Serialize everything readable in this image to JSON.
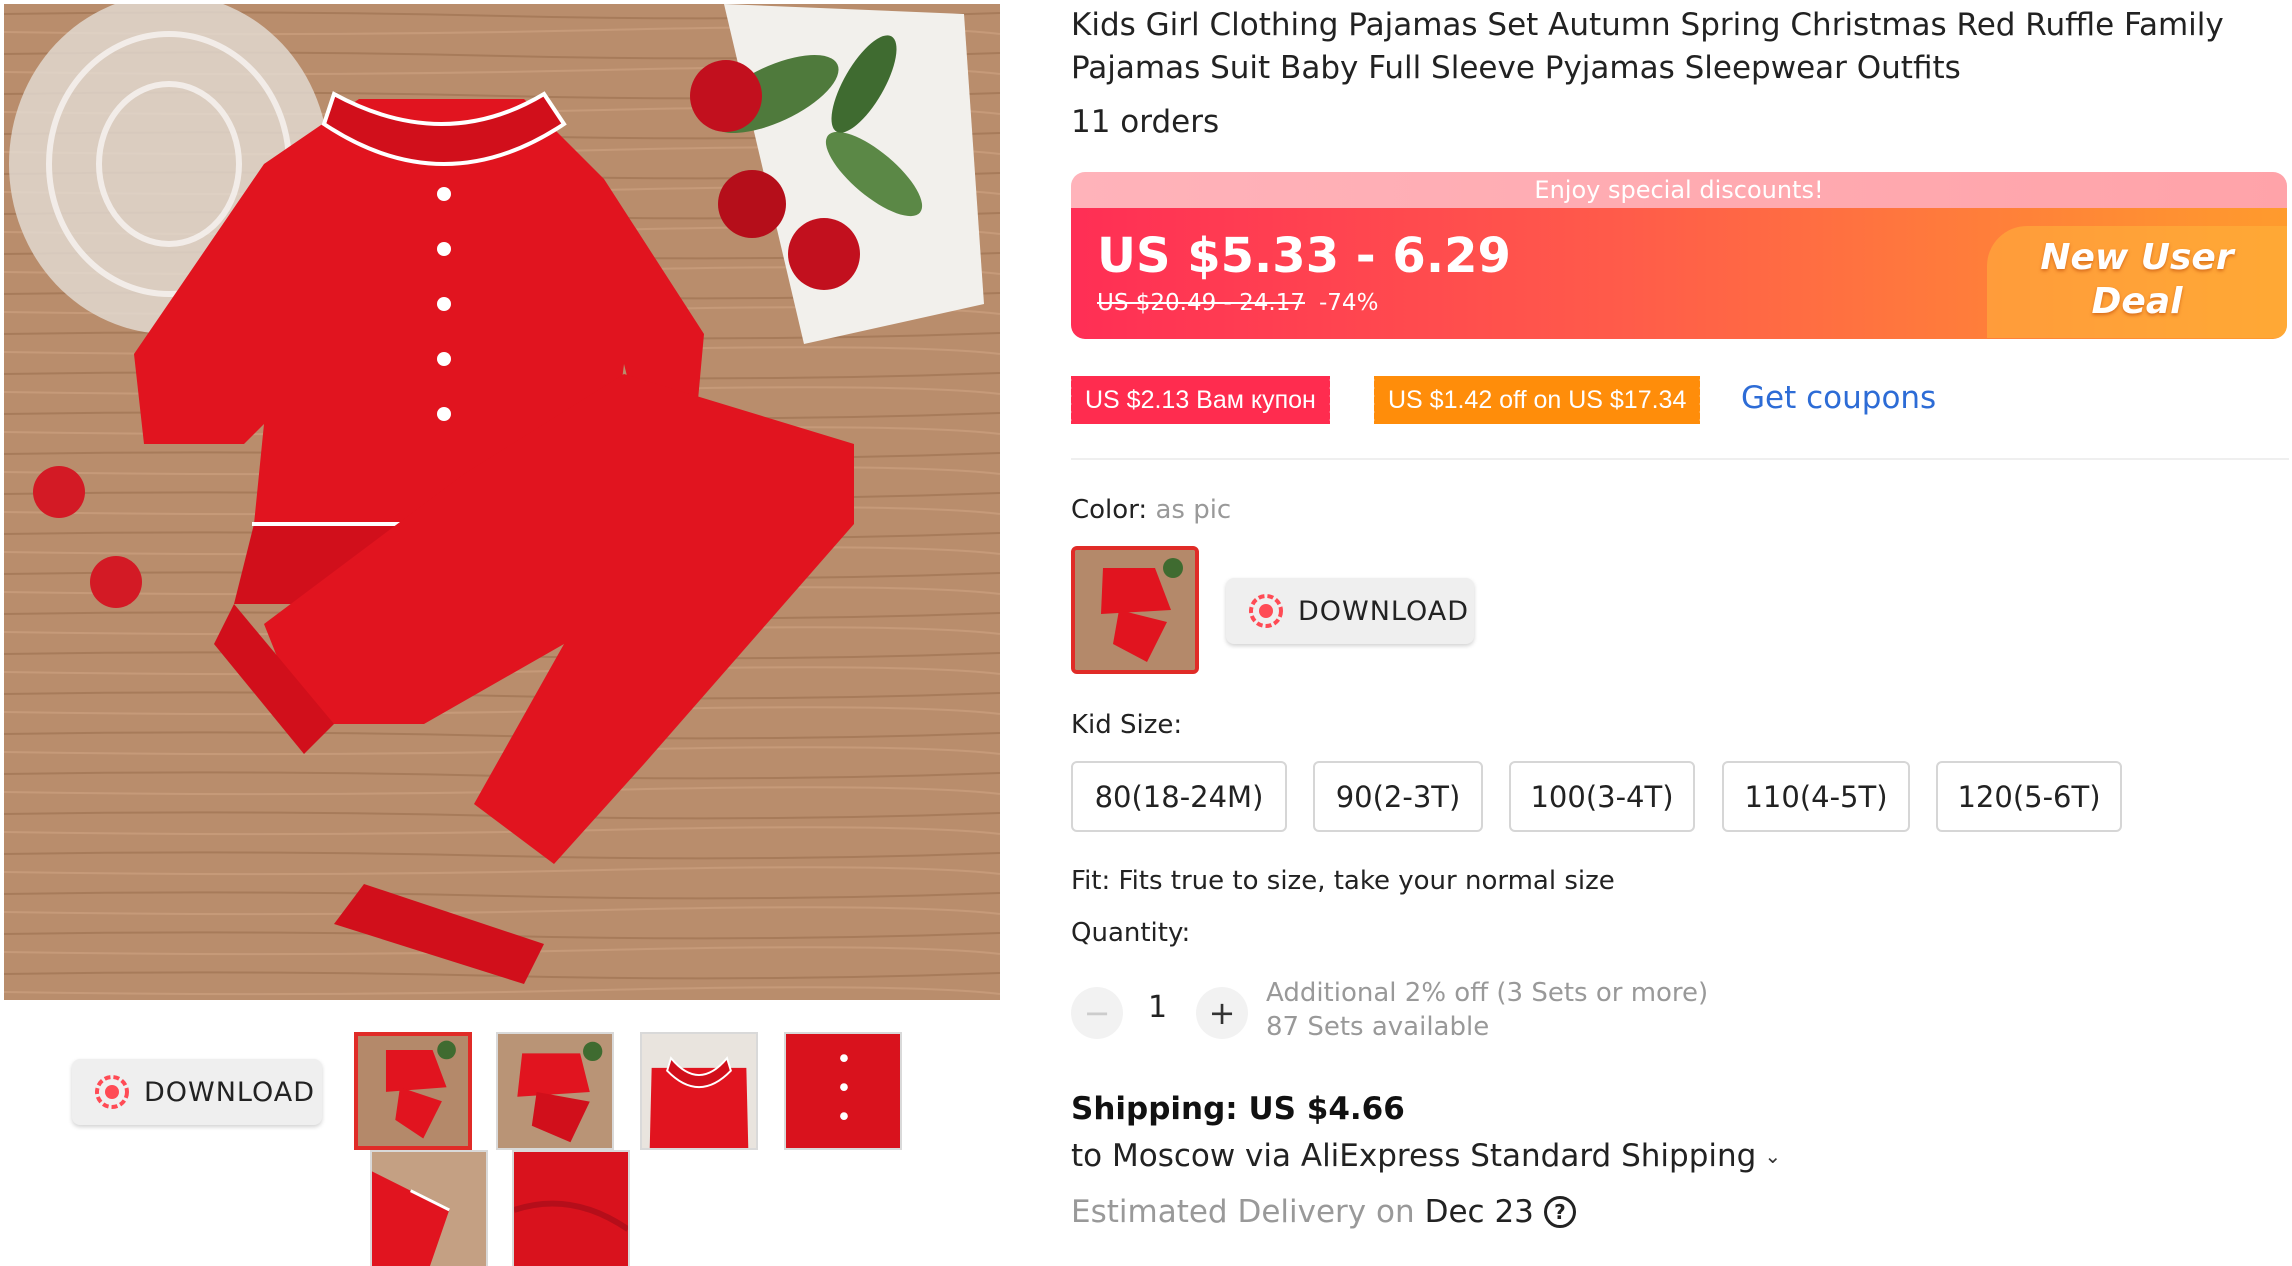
{
  "product": {
    "title": "Kids Girl Clothing Pajamas Set Autumn Spring Christmas Red Ruffle Family Pajamas Suit Baby Full Sleeve Pyjamas Sleepwear Outfits",
    "orders": "11 orders"
  },
  "gallery": {
    "download_label": "DOWNLOAD",
    "thumbnails": [
      "thumbnail-1",
      "thumbnail-2",
      "thumbnail-3",
      "thumbnail-4",
      "thumbnail-5",
      "thumbnail-6"
    ],
    "active_index": 0
  },
  "price": {
    "banner": "Enjoy special discounts!",
    "range": "US $5.33 - 6.29",
    "original": "US $20.49 - 24.17",
    "discount": "-74%",
    "deal_line1": "New User",
    "deal_line2": "Deal"
  },
  "coupons": {
    "coupon1": "US $2.13 Вам купон",
    "coupon2": "US $1.42 off on US $17.34",
    "get_link": "Get coupons"
  },
  "options": {
    "color_label": "Color:",
    "color_value": "as pic",
    "download_label": "DOWNLOAD",
    "size_label": "Kid Size:",
    "sizes": [
      "80(18-24M)",
      "90(2-3T)",
      "100(3-4T)",
      "110(4-5T)",
      "120(5-6T)"
    ],
    "fit": "Fit: Fits true to size, take your normal size"
  },
  "quantity": {
    "label": "Quantity:",
    "minus": "−",
    "plus": "+",
    "value": "1",
    "note1": "Additional 2% off (3 Sets or more)",
    "note2": "87 Sets available"
  },
  "shipping": {
    "title": "Shipping: US $4.66",
    "route": "to Moscow via AliExpress Standard Shipping",
    "chevron": "⌄",
    "delivery_prefix": "Estimated Delivery on",
    "delivery_date": "Dec 23",
    "help": "?"
  },
  "colors": {
    "accent_red": "#ff2c4f",
    "accent_orange": "#ff8d0a",
    "link_blue": "#2d6cd6",
    "selected_border": "#e02b27"
  },
  "icons": {
    "download": "download-icon",
    "help": "question-circle-icon",
    "chevron": "chevron-down-icon"
  }
}
